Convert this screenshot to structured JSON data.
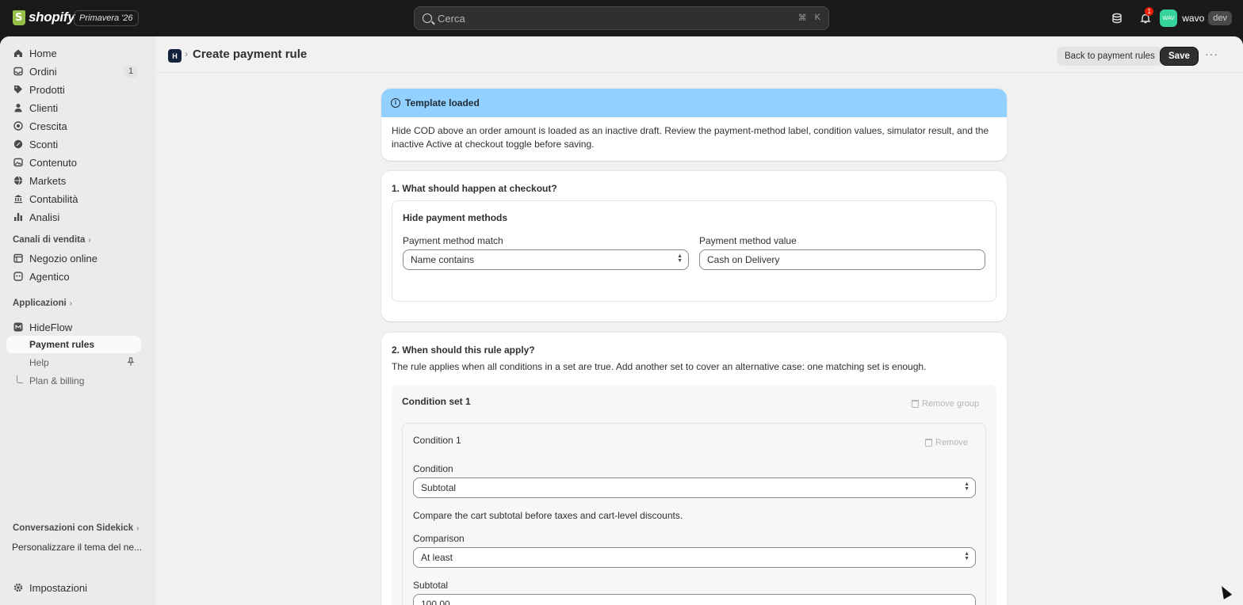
{
  "topbar": {
    "brand": "shopify",
    "edition": "Primavera '26",
    "search_placeholder": "Cerca",
    "search_kbd_1": "⌘",
    "search_kbd_2": "K",
    "notification_count": "1",
    "avatar_initials": "WAV",
    "store_name": "wavo",
    "env_badge": "dev"
  },
  "sidebar": {
    "items": [
      {
        "label": "Home",
        "icon": "home-icon"
      },
      {
        "label": "Ordini",
        "icon": "inbox-icon",
        "count": "1"
      },
      {
        "label": "Prodotti",
        "icon": "tag-icon"
      },
      {
        "label": "Clienti",
        "icon": "person-icon"
      },
      {
        "label": "Crescita",
        "icon": "target-icon"
      },
      {
        "label": "Sconti",
        "icon": "discount-icon"
      },
      {
        "label": "Contenuto",
        "icon": "content-icon"
      },
      {
        "label": "Markets",
        "icon": "globe-icon"
      },
      {
        "label": "Contabilità",
        "icon": "bank-icon"
      },
      {
        "label": "Analisi",
        "icon": "chart-icon"
      }
    ],
    "sales_channels_label": "Canali di vendita",
    "channels": [
      {
        "label": "Negozio online",
        "icon": "store-icon"
      },
      {
        "label": "Agentico",
        "icon": "agent-icon"
      }
    ],
    "apps_label": "Applicazioni",
    "app": {
      "label": "HideFlow",
      "icon": "app-icon"
    },
    "app_subitems": [
      "Payment rules",
      "Help",
      "Plan & billing"
    ],
    "sidekick_label": "Conversazioni con Sidekick",
    "sidekick_item": "Personalizzare il tema del ne...",
    "settings_label": "Impostazioni"
  },
  "header": {
    "app_icon_text": "H",
    "title": "Create payment rule",
    "back_button": "Back to payment rules",
    "save_button": "Save",
    "more": "···"
  },
  "banner": {
    "title": "Template loaded",
    "body": "Hide COD above an order amount is loaded as an inactive draft. Review the payment-method label, condition values, simulator result, and the inactive Active at checkout toggle before saving."
  },
  "section1": {
    "title": "1. What should happen at checkout?",
    "box_title": "Hide payment methods",
    "match_label": "Payment method match",
    "match_value": "Name contains",
    "value_label": "Payment method value",
    "value_value": "Cash on Delivery"
  },
  "section2": {
    "title": "2. When should this rule apply?",
    "description": "The rule applies when all conditions in a set are true. Add another set to cover an alternative case: one matching set is enough.",
    "set_title": "Condition set 1",
    "remove_group": "Remove group",
    "condition_title": "Condition 1",
    "remove": "Remove",
    "condition_label": "Condition",
    "condition_value": "Subtotal",
    "condition_help": "Compare the cart subtotal before taxes and cart-level discounts.",
    "comparison_label": "Comparison",
    "comparison_value": "At least",
    "subtotal_label": "Subtotal",
    "subtotal_value": "100.00"
  }
}
